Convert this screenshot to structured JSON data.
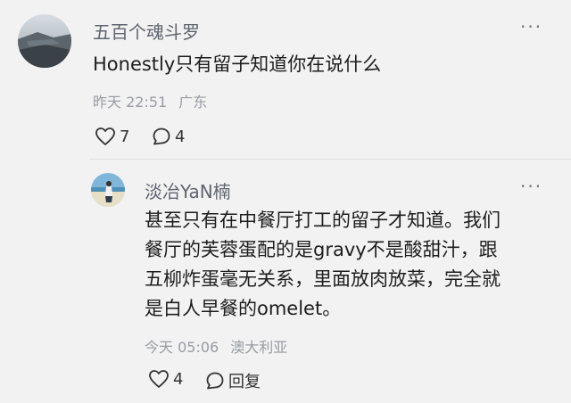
{
  "comments": [
    {
      "username": "五百个魂斗罗",
      "content": "Honestly只有留子知道你在说什么",
      "time": "昨天 22:51",
      "location": "广东",
      "likes": "7",
      "replies": "4",
      "more": "···"
    }
  ],
  "reply": {
    "username": "淡冶YaN楠",
    "content_lines": [
      "甚至只有在中餐厅打工的留子才知道。我们",
      "餐厅的芙蓉蛋配的是gravy不是酸甜汁，跟",
      "五柳炸蛋毫无关系，里面放肉放菜，完全就",
      "是白人早餐的omelet。"
    ],
    "time": "今天 05:06",
    "location": "澳大利亚",
    "likes": "4",
    "reply_label": "回复",
    "more": "···"
  },
  "icons": {
    "like": "heart-outline-icon",
    "comment": "comment-bubble-icon",
    "more": "more-dots-icon"
  },
  "colors": {
    "background": "#f2f2f2",
    "username": "#60646f",
    "content": "#1d1d1d",
    "meta": "#9a9ca3"
  }
}
